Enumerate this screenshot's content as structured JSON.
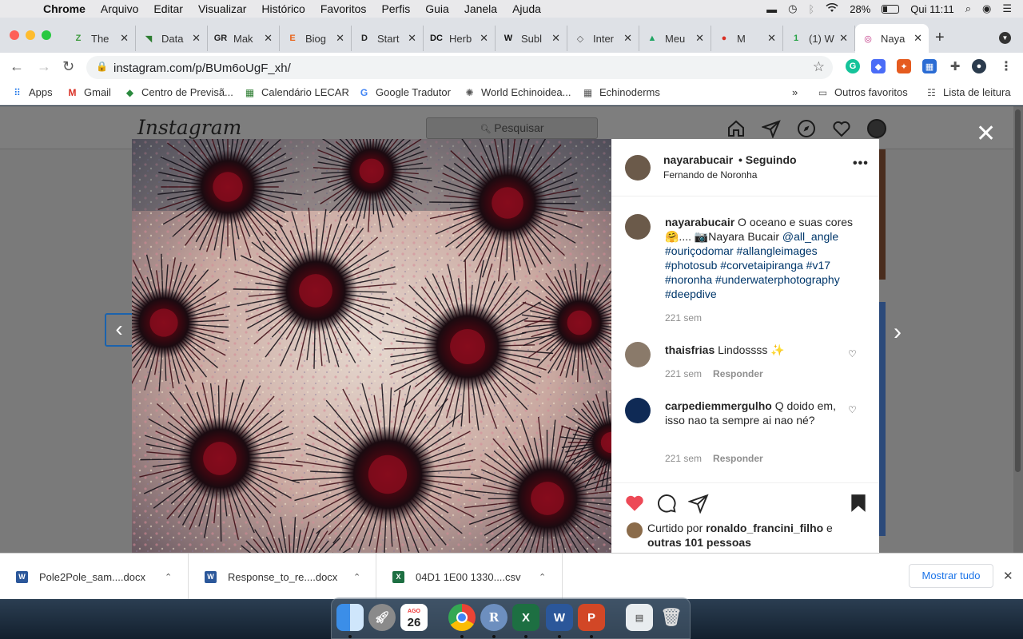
{
  "menubar": {
    "app": "Chrome",
    "items": [
      "Arquivo",
      "Editar",
      "Visualizar",
      "Histórico",
      "Favoritos",
      "Perfis",
      "Guia",
      "Janela",
      "Ajuda"
    ],
    "battery": "28%",
    "clock": "Qui 11:11"
  },
  "tabs": [
    {
      "label": "The",
      "fav": "Z",
      "color": "#3d9a3d"
    },
    {
      "label": "Data",
      "fav": "◥",
      "color": "#2e7d32"
    },
    {
      "label": "Mak",
      "fav": "GR",
      "color": "#222222"
    },
    {
      "label": "Biog",
      "fav": "E",
      "color": "#e8641b"
    },
    {
      "label": "Start",
      "fav": "D",
      "color": "#222222"
    },
    {
      "label": "Herb",
      "fav": "DC",
      "color": "#111111"
    },
    {
      "label": "Subl",
      "fav": "W",
      "color": "#111111"
    },
    {
      "label": "Inter",
      "fav": "◇",
      "color": "#555555"
    },
    {
      "label": "Meu",
      "fav": "▲",
      "color": "#1fa463"
    },
    {
      "label": "M",
      "fav": "●",
      "color": "#d93025"
    },
    {
      "label": "(1) W",
      "fav": "1",
      "color": "#25a244"
    },
    {
      "label": "Naya",
      "fav": "◎",
      "color": "#c13584"
    }
  ],
  "toolbar": {
    "url": "instagram.com/p/BUm6oUgF_xh/"
  },
  "bookmarks": [
    {
      "label": "Apps",
      "icon": "apps-grid-icon"
    },
    {
      "label": "Gmail",
      "icon": "gmail-icon"
    },
    {
      "label": "Centro de Previsã...",
      "icon": "flag-icon"
    },
    {
      "label": "Calendário LECAR",
      "icon": "calendar-icon"
    },
    {
      "label": "Google Tradutor",
      "icon": "translate-icon"
    },
    {
      "label": "World Echinoidea...",
      "icon": "globe-icon"
    },
    {
      "label": "Echinoderms",
      "icon": "grid-icon"
    }
  ],
  "bookmarks_right": {
    "overflow": "»",
    "others": "Outros favoritos",
    "reading": "Lista de leitura"
  },
  "instagram": {
    "logo": "Instagram",
    "search_placeholder": "Pesquisar"
  },
  "post": {
    "username": "nayarabucair",
    "follow_status": "• Seguindo",
    "location": "Fernando de Noronha",
    "caption_user": "nayarabucair",
    "caption_text": " O oceano e suas cores 🤗.... 📷Nayara Bucair ",
    "caption_tags": "@all_angle #ouriçodomar #allangleimages #photosub #corvetaipiranga #v17 #noronha #underwaterphotography #deepdive",
    "caption_time": "221 sem",
    "comments": [
      {
        "user": "thaisfrias",
        "text": " Lindossss ✨",
        "time": "221 sem",
        "reply": "Responder"
      },
      {
        "user": "carpediemmergulho",
        "text": " Q doido em, isso nao ta sempre ai nao né?",
        "time": "221 sem",
        "reply": "Responder"
      }
    ],
    "liked_prefix": "Curtido por ",
    "liked_user": "ronaldo_francini_filho",
    "liked_mid": " e",
    "liked_others": "outras 101 pessoas"
  },
  "downloads": [
    {
      "name": "Pole2Pole_sam....docx",
      "type": "docx"
    },
    {
      "name": "Response_to_re....docx",
      "type": "docx"
    },
    {
      "name": "04D1 1E00 1330....csv",
      "type": "csv"
    }
  ],
  "downloads_show_all": "Mostrar tudo",
  "dock": {
    "calendar_day": "26",
    "calendar_month": "AGO"
  },
  "colors": {
    "like_red": "#ed4956",
    "link_blue": "#00376b",
    "chrome_tab_bg": "#dee1e6"
  }
}
